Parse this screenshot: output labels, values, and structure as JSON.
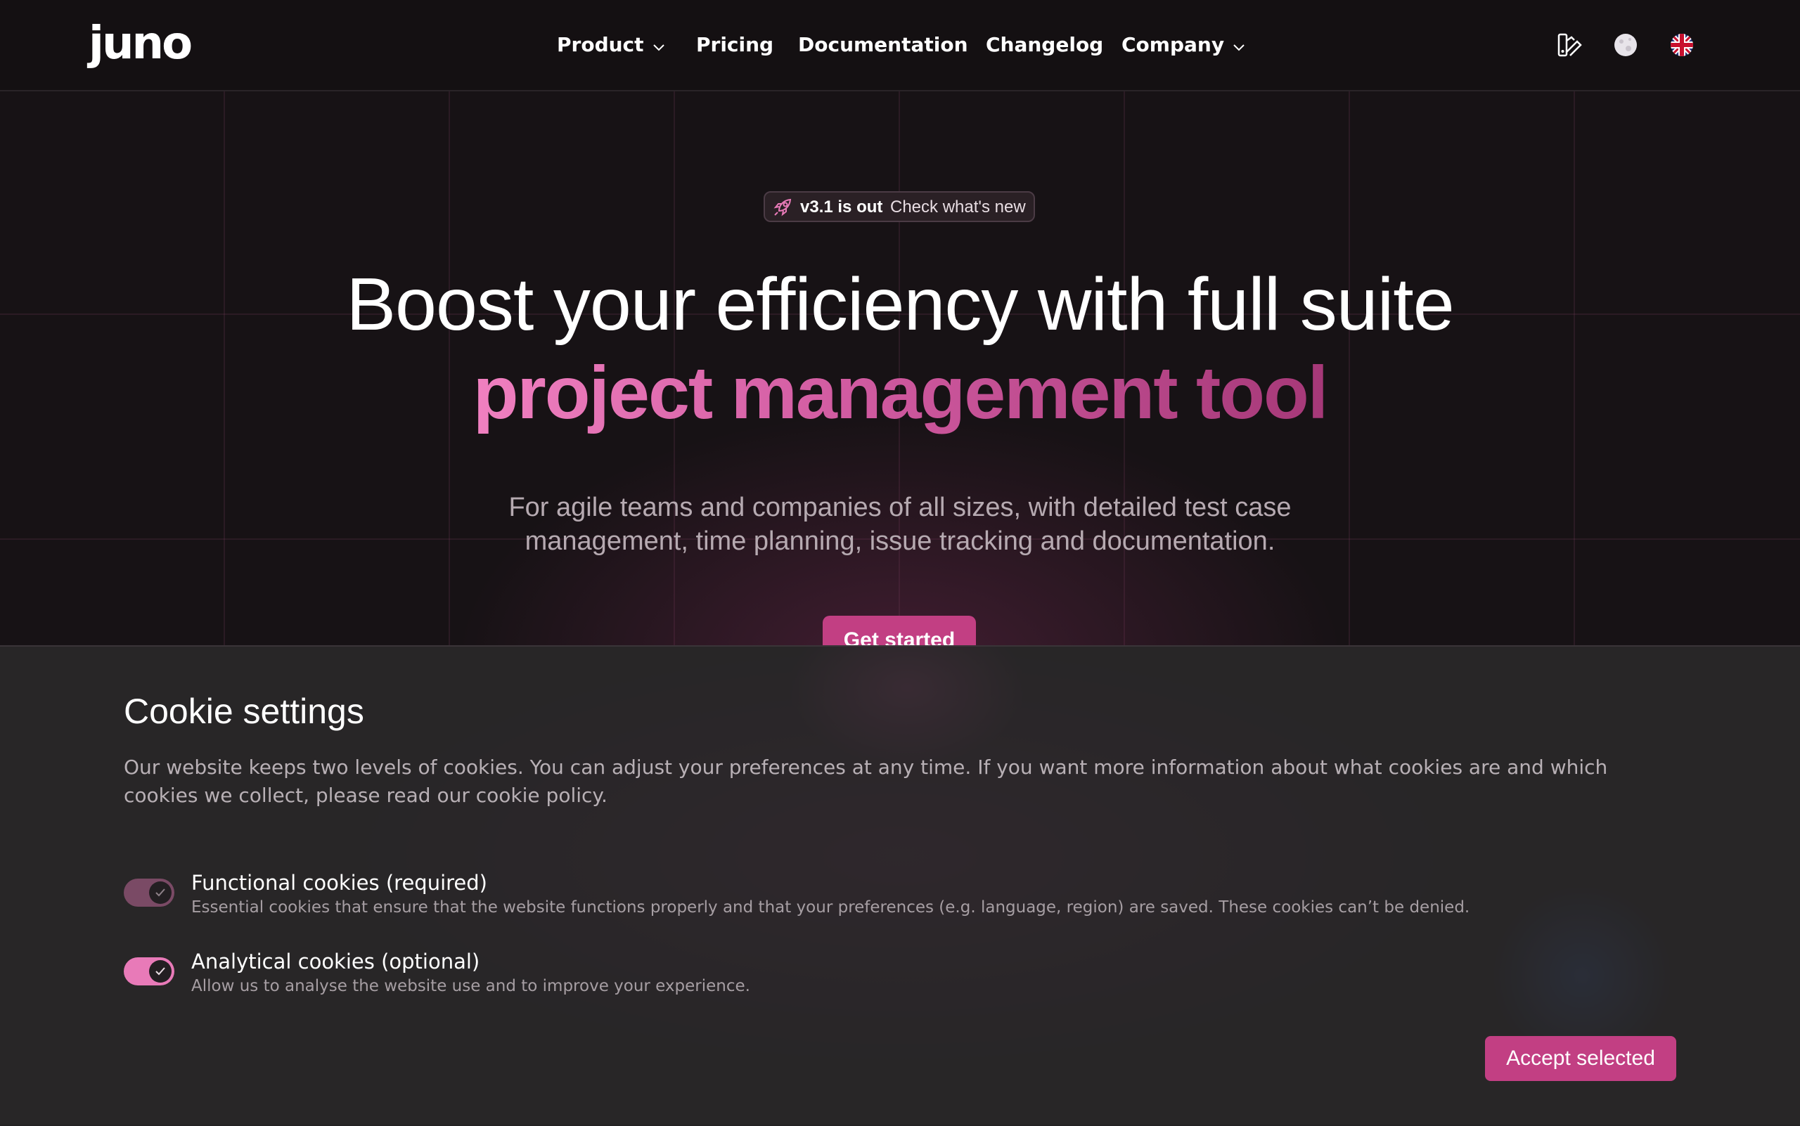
{
  "header": {
    "logo": "juno",
    "nav": [
      {
        "label": "Product",
        "has_dropdown": true
      },
      {
        "label": "Pricing",
        "has_dropdown": false
      },
      {
        "label": "Documentation",
        "has_dropdown": false
      },
      {
        "label": "Changelog",
        "has_dropdown": false
      },
      {
        "label": "Company",
        "has_dropdown": true
      }
    ],
    "icons": [
      "theme-palette-icon",
      "moon-icon",
      "uk-flag-icon"
    ]
  },
  "hero": {
    "badge_strong": "v3.1 is out",
    "badge_text": "Check what's new",
    "badge_icon": "rocket-icon",
    "headline_line1": "Boost your efficiency with full suite",
    "headline_line2": "project management tool",
    "subtitle_line1": "For agile teams and companies of all sizes, with detailed test case",
    "subtitle_line2": "management, time planning, issue tracking and documentation.",
    "cta_label": "Get started"
  },
  "cookie": {
    "title": "Cookie settings",
    "description": "Our website keeps two levels of cookies. You can adjust your preferences at any time. If you want more information about what cookies are and which cookies we collect, please read our cookie policy.",
    "options": [
      {
        "label": "Functional cookies (required)",
        "description": "Essential cookies that ensure that the website functions properly and that your preferences (e.g. language, region) are saved. These cookies can’t be denied.",
        "checked": true,
        "disabled": true
      },
      {
        "label": "Analytical cookies (optional)",
        "description": "Allow us to analyse the website use and to improve your experience.",
        "checked": true,
        "disabled": false
      }
    ],
    "accept_label": "Accept selected"
  },
  "colors": {
    "accent": "#c23f83",
    "accent_light": "#f080c0",
    "background": "#151114",
    "panel": "#2a2628"
  }
}
